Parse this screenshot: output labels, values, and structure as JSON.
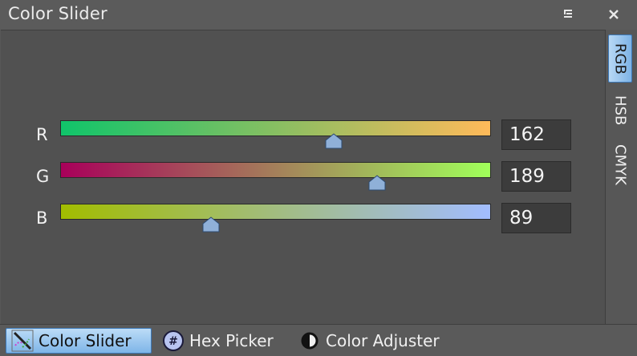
{
  "window": {
    "title": "Color Slider"
  },
  "sliders": [
    {
      "label": "R",
      "value": "162",
      "fraction": 0.635,
      "from": "#10c46a",
      "to": "#ffba5a"
    },
    {
      "label": "G",
      "value": "189",
      "fraction": 0.735,
      "from": "#a8005a",
      "to": "#a0ff5a"
    },
    {
      "label": "B",
      "value": "89",
      "fraction": 0.35,
      "from": "#a2bd00",
      "to": "#a2bdff"
    }
  ],
  "side_tabs": [
    {
      "label": "RGB",
      "active": true
    },
    {
      "label": "HSB"
    },
    {
      "label": "CMYK"
    }
  ],
  "bottom_tabs": [
    {
      "label": "Color Slider",
      "active": true
    },
    {
      "label": "Hex Picker"
    },
    {
      "label": "Color Adjuster"
    }
  ],
  "colors": {
    "accent": "#7db3e6",
    "thumb": "#8fb0d8"
  }
}
